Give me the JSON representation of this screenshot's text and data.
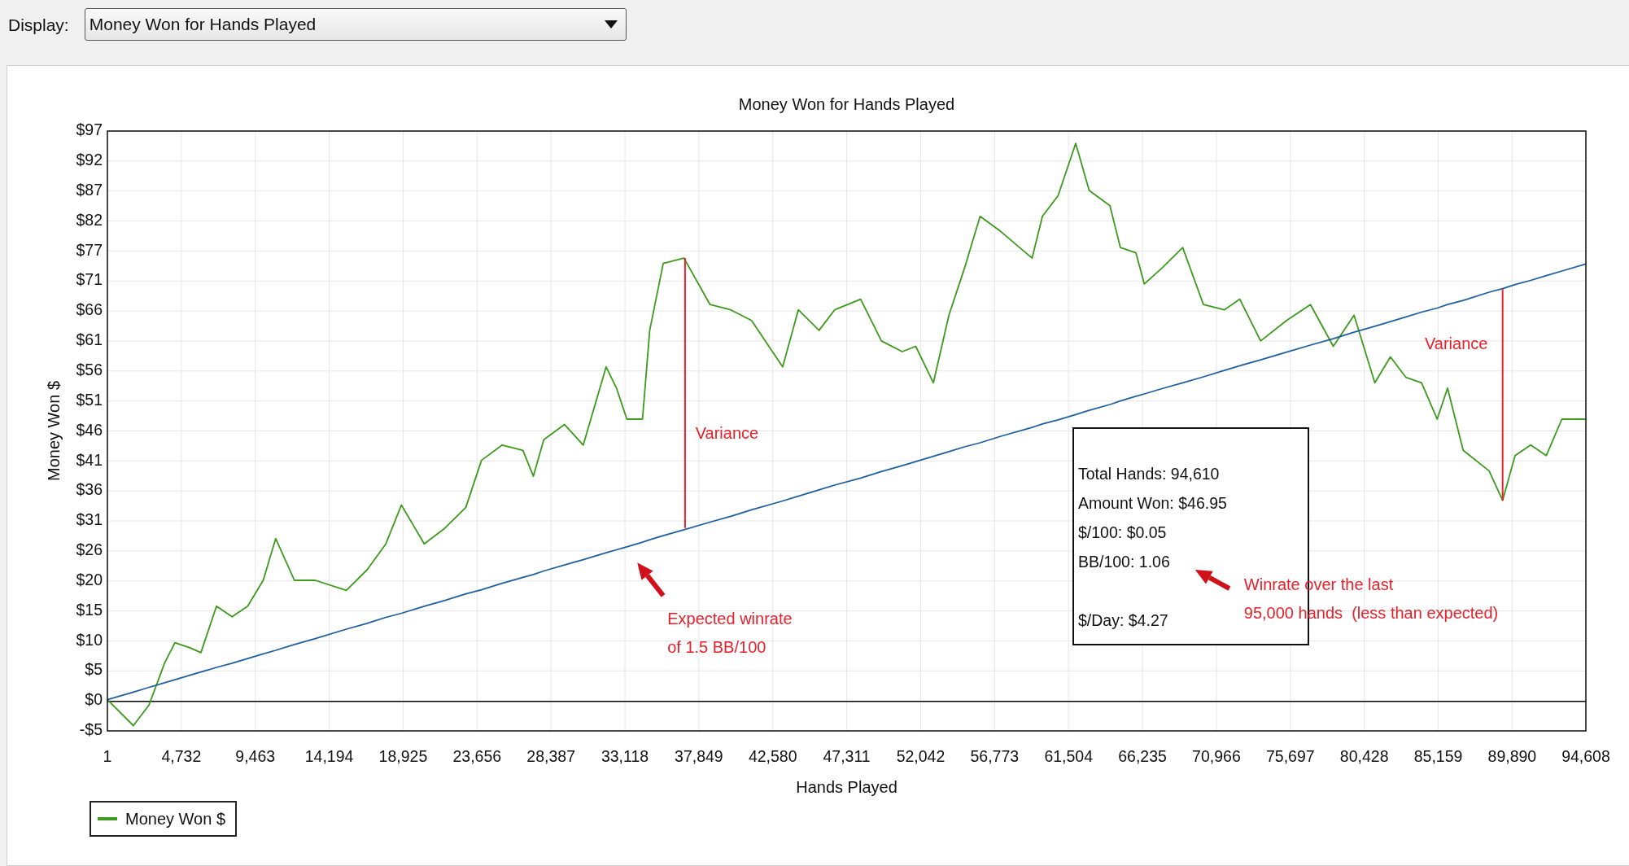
{
  "display": {
    "label": "Display:",
    "value": "Money Won for Hands Played"
  },
  "chart": {
    "chart_data": {
      "type": "line",
      "title": "Money Won for Hands Played",
      "xlabel": "Hands Played",
      "ylabel": "Money Won $",
      "x": [
        1,
        1663,
        2660,
        3657,
        4322,
        5319,
        5984,
        6981,
        7979,
        8976,
        9973,
        10771,
        11968,
        13297,
        15292,
        16621,
        17818,
        18815,
        20278,
        21607,
        22937,
        23934,
        25264,
        26593,
        27258,
        27923,
        29252,
        30449,
        31912,
        32577,
        33242,
        34239,
        34704,
        35569,
        36898,
        38560,
        39890,
        41219,
        43214,
        44211,
        45541,
        46537,
        48199,
        49529,
        50859,
        51723,
        52853,
        53850,
        54847,
        55845,
        57174,
        59169,
        59833,
        60831,
        61961,
        62825,
        64155,
        64820,
        65817,
        66349,
        67479,
        68809,
        70138,
        71468,
        72465,
        73795,
        75457,
        76982,
        78445,
        79775,
        81104,
        82101,
        83098,
        84096,
        85093,
        85758,
        86755,
        88417,
        89281,
        90079,
        91076,
        92073,
        93070,
        94600
      ],
      "series": [
        {
          "name": "Money Won $",
          "color": "#3c9a1c",
          "values": [
            0.3,
            -4.1,
            -0.6,
            6.5,
            10,
            9.1,
            8.3,
            16.2,
            14.4,
            16.2,
            20.6,
            27.7,
            20.6,
            20.6,
            18.9,
            22.4,
            26.8,
            33.4,
            26.8,
            29.5,
            33,
            41,
            43.6,
            42.7,
            38.3,
            44.5,
            47.1,
            43.6,
            56.9,
            53.3,
            48,
            48,
            63.1,
            74.5,
            75.4,
            67.5,
            66.6,
            64.8,
            56.9,
            66.6,
            63.1,
            66.6,
            68.4,
            61.3,
            59.5,
            60.4,
            54.2,
            65.7,
            73.7,
            82.5,
            79.9,
            75.4,
            82.5,
            86,
            94.9,
            86.9,
            84.3,
            77.2,
            76.3,
            71,
            73.7,
            77.2,
            67.5,
            66.6,
            68.4,
            61.3,
            64.8,
            67.5,
            60.4,
            65.7,
            54.2,
            58.6,
            55.1,
            54.2,
            48,
            53.3,
            42.7,
            39.2,
            34.2,
            41.8,
            43.6,
            41.8,
            48,
            48
          ]
        },
        {
          "color": "#1f5f9e",
          "values": [
            0.3,
            1.6,
            2.4,
            3.2,
            3.7,
            4.5,
            5.0,
            5.8,
            6.5,
            7.3,
            8.1,
            8.7,
            9.7,
            10.7,
            12.3,
            13.3,
            14.3,
            15.0,
            16.2,
            17.2,
            18.3,
            19.0,
            20.1,
            21.1,
            21.6,
            22.2,
            23.2,
            24.1,
            25.3,
            25.8,
            26.3,
            27.1,
            27.5,
            28.2,
            29.2,
            30.5,
            31.5,
            32.6,
            34.1,
            34.9,
            36.0,
            36.8,
            38.0,
            39.1,
            40.1,
            40.8,
            41.7,
            42.5,
            43.3,
            44.0,
            45.1,
            46.6,
            47.2,
            47.9,
            48.8,
            49.5,
            50.5,
            51.1,
            51.9,
            52.3,
            53.2,
            54.2,
            55.2,
            56.3,
            57.1,
            58.1,
            59.4,
            60.6,
            61.7,
            62.8,
            63.8,
            64.6,
            65.4,
            66.2,
            66.9,
            67.5,
            68.2,
            69.6,
            70.2,
            70.9,
            71.6,
            72.4,
            73.2,
            74.4
          ]
        }
      ],
      "grid": true,
      "xlim": [
        1,
        94608
      ],
      "ylim": [
        -5,
        97
      ],
      "xticks": [
        {
          "value": 1,
          "label": "1"
        },
        {
          "value": 4732,
          "label": "4,732"
        },
        {
          "value": 9463,
          "label": "9,463"
        },
        {
          "value": 14194,
          "label": "14,194"
        },
        {
          "value": 18925,
          "label": "18,925"
        },
        {
          "value": 23656,
          "label": "23,656"
        },
        {
          "value": 28387,
          "label": "28,387"
        },
        {
          "value": 33118,
          "label": "33,118"
        },
        {
          "value": 37849,
          "label": "37,849"
        },
        {
          "value": 42580,
          "label": "42,580"
        },
        {
          "value": 47311,
          "label": "47,311"
        },
        {
          "value": 52042,
          "label": "52,042"
        },
        {
          "value": 56773,
          "label": "56,773"
        },
        {
          "value": 61504,
          "label": "61,504"
        },
        {
          "value": 66235,
          "label": "66,235"
        },
        {
          "value": 70966,
          "label": "70,966"
        },
        {
          "value": 75697,
          "label": "75,697"
        },
        {
          "value": 80428,
          "label": "80,428"
        },
        {
          "value": 85159,
          "label": "85,159"
        },
        {
          "value": 89890,
          "label": "89,890"
        },
        {
          "value": 94608,
          "label": "94,608"
        }
      ],
      "yticks": [
        {
          "value": -5,
          "label": "-$5"
        },
        {
          "value": 0.1,
          "label": "$0"
        },
        {
          "value": 5.2,
          "label": "$5"
        },
        {
          "value": 10.3,
          "label": "$10"
        },
        {
          "value": 15.4,
          "label": "$15"
        },
        {
          "value": 20.5,
          "label": "$20"
        },
        {
          "value": 25.6,
          "label": "$26"
        },
        {
          "value": 30.7,
          "label": "$31"
        },
        {
          "value": 35.8,
          "label": "$36"
        },
        {
          "value": 40.9,
          "label": "$41"
        },
        {
          "value": 46,
          "label": "$46"
        },
        {
          "value": 51.1,
          "label": "$51"
        },
        {
          "value": 56.2,
          "label": "$56"
        },
        {
          "value": 61.3,
          "label": "$61"
        },
        {
          "value": 66.4,
          "label": "$66"
        },
        {
          "value": 71.5,
          "label": "$71"
        },
        {
          "value": 76.6,
          "label": "$77"
        },
        {
          "value": 81.7,
          "label": "$82"
        },
        {
          "value": 86.8,
          "label": "$87"
        },
        {
          "value": 91.9,
          "label": "$92"
        },
        {
          "value": 97,
          "label": "$97"
        }
      ],
      "annotations": [
        "Variance",
        "Variance",
        "Expected winrate",
        "of 1.5 BB/100",
        "Winrate over the last",
        "95,000 hands  (less than expected)"
      ]
    },
    "info_box": {
      "lines": [
        {
          "kind": "stat",
          "text": "Total Hands: 94,610"
        },
        {
          "kind": "stat",
          "text": "Amount Won: $46.95"
        },
        {
          "kind": "stat",
          "text": "$/100: $0.05"
        },
        {
          "kind": "stat",
          "text": "BB/100: 1.06"
        },
        {
          "kind": "spaced",
          "text": "$/Day: $4.27"
        }
      ]
    }
  }
}
